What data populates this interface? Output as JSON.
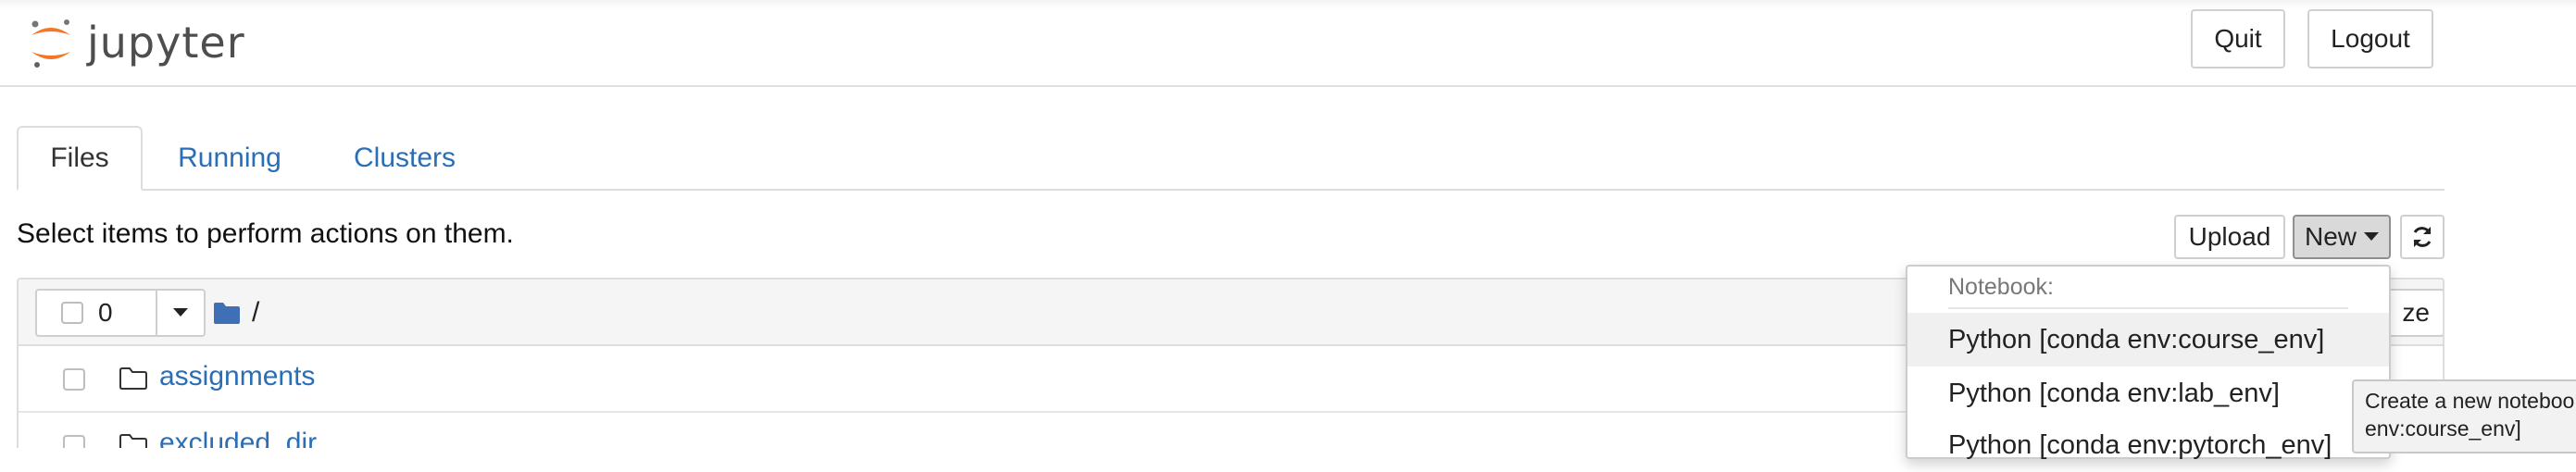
{
  "header": {
    "logo_text": "jupyter",
    "quit_label": "Quit",
    "logout_label": "Logout"
  },
  "tabs": [
    {
      "label": "Files"
    },
    {
      "label": "Running"
    },
    {
      "label": "Clusters"
    }
  ],
  "hint": "Select items to perform actions on them.",
  "toolbar": {
    "upload_label": "Upload",
    "new_label": "New",
    "refresh_icon": "refresh-icon"
  },
  "list": {
    "selected_count": "0",
    "breadcrumb_sep": "/",
    "partial_button_text": "ze",
    "items": [
      {
        "name": "assignments",
        "type": "folder"
      },
      {
        "name": "excluded_dir",
        "type": "folder"
      }
    ]
  },
  "new_menu": {
    "header": "Notebook:",
    "items": [
      {
        "label": "Python [conda env:course_env]"
      },
      {
        "label": "Python [conda env:lab_env]"
      },
      {
        "label": "Python [conda env:pytorch_env]"
      }
    ]
  },
  "tooltip": {
    "line1": "Create a new noteboo",
    "line2": "env:course_env]"
  },
  "colors": {
    "link": "#2a6eb5",
    "logo_orange": "#f37726",
    "folder_blue": "#3f6fb5"
  }
}
